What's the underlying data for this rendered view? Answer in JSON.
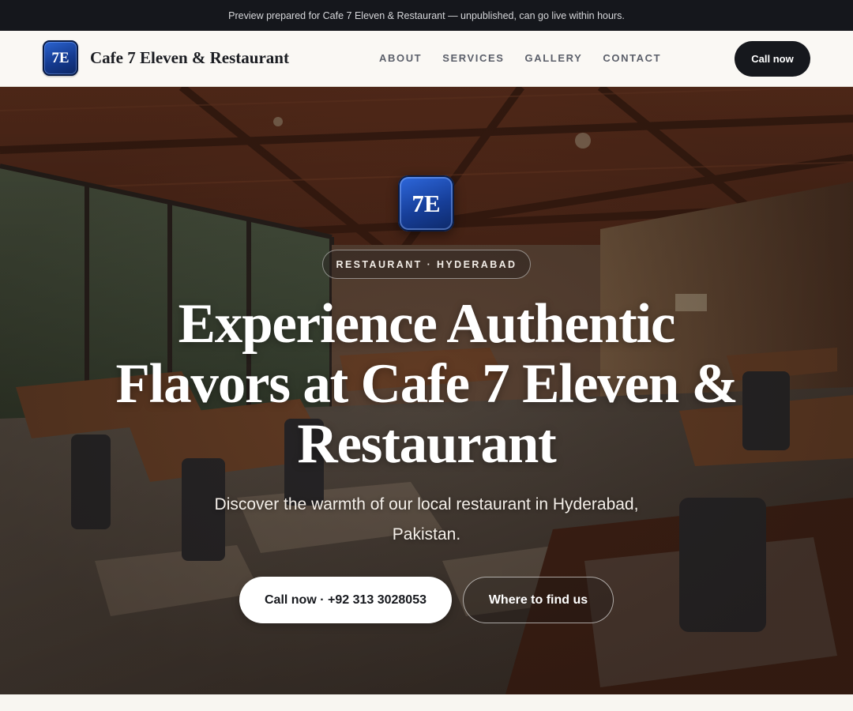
{
  "topbar": {
    "text": "Preview prepared for Cafe 7 Eleven & Restaurant — unpublished, can go live within hours."
  },
  "nav": {
    "logo_text": "7E",
    "brand_name": "Cafe 7 Eleven & Restaurant",
    "links": [
      "ABOUT",
      "SERVICES",
      "GALLERY",
      "CONTACT"
    ],
    "cta_label": "Call now"
  },
  "hero": {
    "logo_text": "7E",
    "badge": "RESTAURANT · HYDERABAD",
    "headline": "Experience Authentic Flavors at Cafe 7 Eleven & Restaurant",
    "subtitle": "Discover the warmth of our local restaurant in Hyderabad, Pakistan.",
    "primary_cta": "Call now · +92 313 3028053",
    "secondary_cta": "Where to find us",
    "background_image": "restaurant-interior-photo"
  },
  "colors": {
    "topbar_bg": "#15171c",
    "nav_bg": "#faf8f4",
    "dark_button": "#16181d",
    "logo_blue": "#173f9a"
  }
}
